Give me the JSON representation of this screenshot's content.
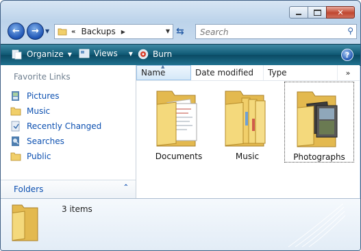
{
  "window": {
    "title": "Backups"
  },
  "address": {
    "overflow": "«",
    "crumbs": [
      "Backups"
    ]
  },
  "search": {
    "placeholder": "Search"
  },
  "toolbar": {
    "organize": "Organize",
    "views": "Views",
    "burn": "Burn",
    "help": "?"
  },
  "nav": {
    "favorites_title": "Favorite Links",
    "items": [
      {
        "label": "Pictures",
        "icon": "pictures-icon"
      },
      {
        "label": "Music",
        "icon": "folder-icon"
      },
      {
        "label": "Recently Changed",
        "icon": "recently-changed-icon"
      },
      {
        "label": "Searches",
        "icon": "searches-icon"
      },
      {
        "label": "Public",
        "icon": "folder-icon"
      }
    ],
    "folders_label": "Folders"
  },
  "columns": {
    "name": "Name",
    "date": "Date modified",
    "type": "Type",
    "more": "»"
  },
  "items": [
    {
      "name": "Documents",
      "selected": false
    },
    {
      "name": "Music",
      "selected": false
    },
    {
      "name": "Photographs",
      "selected": true
    }
  ],
  "details": {
    "count": "3 items"
  },
  "colors": {
    "toolbar": "#0e5873",
    "link": "#0b4fb0",
    "folder": "#f4d97c"
  }
}
